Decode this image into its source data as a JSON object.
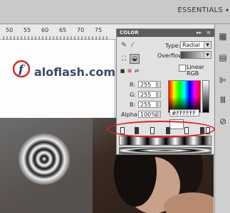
{
  "workspace": {
    "label": "ESSENTIALS"
  },
  "ruler": {
    "labels": [
      "50",
      "55",
      "60",
      "65",
      "70",
      "75"
    ]
  },
  "logo": {
    "text": "aloflash.com"
  },
  "color_panel": {
    "title": "COLOR",
    "type_label": "Type:",
    "type_value": "Radial",
    "overflow_label": "Overflow:",
    "linear_rgb_label": "Linear RGB",
    "r_label": "R:",
    "r_value": "255",
    "g_label": "G:",
    "g_value": "255",
    "b_label": "B:",
    "b_value": "255",
    "alpha_label": "Alpha:",
    "alpha_value": "100%",
    "hex_value": "#FFFFFF",
    "colors": {
      "highlight": "#e02020",
      "swatch": "#ffffff"
    }
  },
  "icons": {
    "collapse": "double-arrow-icon",
    "menu": "panel-menu-icon",
    "stroke": "pencil-icon",
    "fill": "paint-bucket-icon"
  }
}
